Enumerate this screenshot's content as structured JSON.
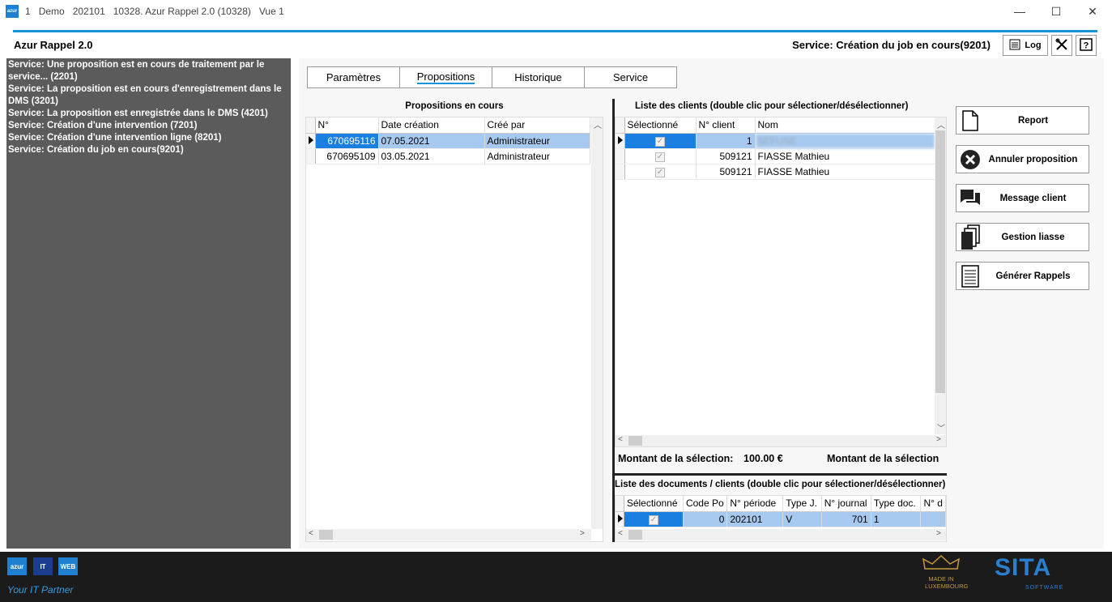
{
  "window": {
    "icon_text": "azur",
    "title_parts": [
      "1",
      "Demo",
      "202101",
      "10328. Azur Rappel 2.0 (10328)",
      "Vue 1"
    ],
    "minimize": "—",
    "maximize": "☐",
    "close": "✕"
  },
  "header": {
    "app_title": "Azur Rappel 2.0",
    "service_status": "Service: Création du job en cours(9201)",
    "log_label": "Log"
  },
  "log_lines": [
    "Service: Une proposition est en cours de traitement par le service... (2201)",
    "Service: La proposition est en cours d'enregistrement dans le DMS (3201)",
    "Service: La proposition est enregistrée dans le DMS (4201)",
    "Service: Création d'une intervention (7201)",
    "Service: Création d'une intervention ligne (8201)",
    "Service: Création du job en cours(9201)"
  ],
  "tabs": [
    {
      "label": "Paramètres"
    },
    {
      "label": "Propositions"
    },
    {
      "label": "Historique"
    },
    {
      "label": "Service"
    }
  ],
  "propositions": {
    "title": "Propositions en cours",
    "columns": [
      "N°",
      "Date création",
      "Créé par"
    ],
    "rows": [
      {
        "num": "670695116",
        "date": "07.05.2021",
        "by": "Administrateur"
      },
      {
        "num": "670695109",
        "date": "03.05.2021",
        "by": "Administrateur"
      }
    ]
  },
  "clients": {
    "title": "Liste des clients   (double clic pour sélectioner/désélectionner)",
    "columns": [
      "Sélectionné",
      "N° client",
      "Nom"
    ],
    "rows": [
      {
        "client": "1",
        "name": "SEFUSE"
      },
      {
        "client": "509121",
        "name": "FIASSE Mathieu"
      },
      {
        "client": "509121",
        "name": "FIASSE Mathieu"
      }
    ]
  },
  "amounts": {
    "selection_label": "Montant de la sélection:",
    "selection_value": "100.00 €",
    "selection_label_2": "Montant de la sélection"
  },
  "documents": {
    "title": "Liste des documents / clients   (double clic pour sélectioner/désélectionner)",
    "columns": [
      "Sélectionné",
      "Code Po",
      "N° période",
      "Type J.",
      "N° journal",
      "Type doc.",
      "N° d"
    ],
    "rows": [
      {
        "code": "0",
        "periode": "202101",
        "type_j": "V",
        "journal": "701",
        "type_doc": "1",
        "nd": ""
      }
    ]
  },
  "actions": [
    {
      "label": "Report",
      "icon": "document-icon"
    },
    {
      "label": "Annuler proposition",
      "icon": "cancel-circle-icon"
    },
    {
      "label": "Message client",
      "icon": "chat-icon"
    },
    {
      "label": "Gestion liasse",
      "icon": "stack-icon"
    },
    {
      "label": "Générer Rappels",
      "icon": "list-document-icon"
    }
  ],
  "footer": {
    "logo_parts": [
      "azur",
      "IT",
      "WEB"
    ],
    "tagline": "Your IT Partner",
    "made_in": "MADE IN LUXEMBOURG",
    "brand": "SITA",
    "brand_sub": "SOFTWARE"
  },
  "colors": {
    "accent": "#1a93d9",
    "log_bg": "#5b5b5b",
    "row_selected": "#a7c9ef",
    "cell_focus": "#1a7fe0",
    "footer_bg": "#1b1b1b"
  }
}
